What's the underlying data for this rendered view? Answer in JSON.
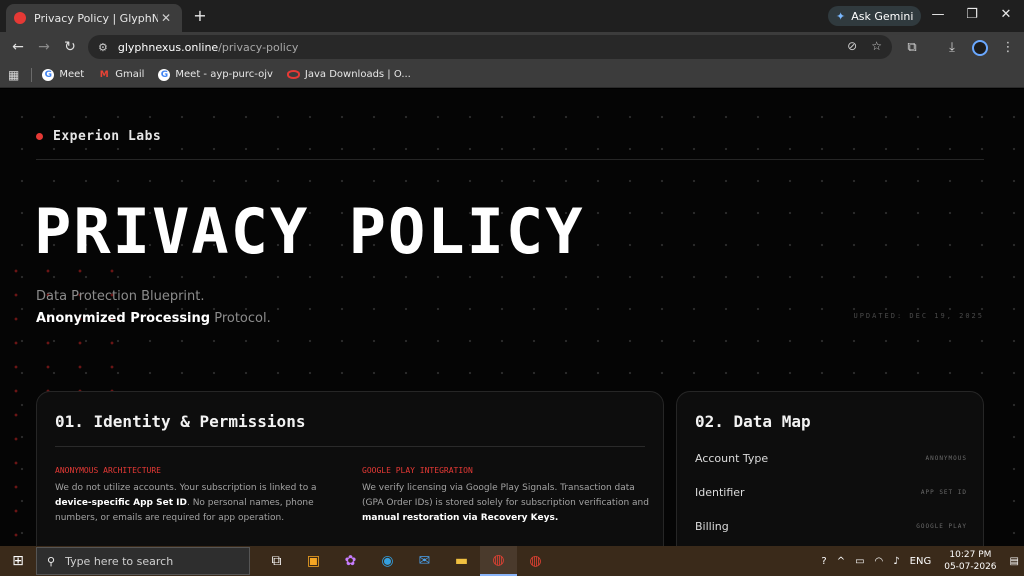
{
  "browser": {
    "tab_title": "Privacy Policy | GlyphNexus",
    "tab_close": "✕",
    "new_tab": "+",
    "ask_gemini": "Ask Gemini",
    "url_host": "glyphnexus.online",
    "url_path": "/privacy-policy",
    "bookmarks": [
      "Meet",
      "Gmail",
      "Meet - ayp-purc-ojv",
      "Java Downloads | O..."
    ]
  },
  "page": {
    "brand": "Experion Labs",
    "hero_title": "PRIVACY POLICY",
    "subtitle_line1": "Data Protection Blueprint.",
    "subtitle_line2_strong": "Anonymized Processing",
    "subtitle_line2_rest": " Protocol.",
    "updated": "UPDATED: DEC 19, 2025",
    "section1": {
      "title": "01. Identity & Permissions",
      "left_label": "ANONYMOUS ARCHITECTURE",
      "left_text_1": "We do not utilize accounts. Your subscription is linked to a ",
      "left_text_bold": "device-specific App Set ID",
      "left_text_2": ". No personal names, phone numbers, or emails are required for app operation.",
      "right_label": "GOOGLE PLAY INTEGRATION",
      "right_text_1": "We verify licensing via Google Play Signals. Transaction data (GPA Order IDs) is stored solely for subscription verification and ",
      "right_text_bold": "manual restoration via Recovery Keys."
    },
    "section2": {
      "title": "02. Data Map",
      "rows": [
        {
          "key": "Account Type",
          "value": "ANONYMOUS"
        },
        {
          "key": "Identifier",
          "value": "APP SET ID"
        },
        {
          "key": "Billing",
          "value": "GOOGLE PLAY"
        }
      ]
    }
  },
  "taskbar": {
    "search_placeholder": "Type here to search",
    "lang": "ENG",
    "time": "10:27 PM",
    "date": "05-07-2026"
  }
}
